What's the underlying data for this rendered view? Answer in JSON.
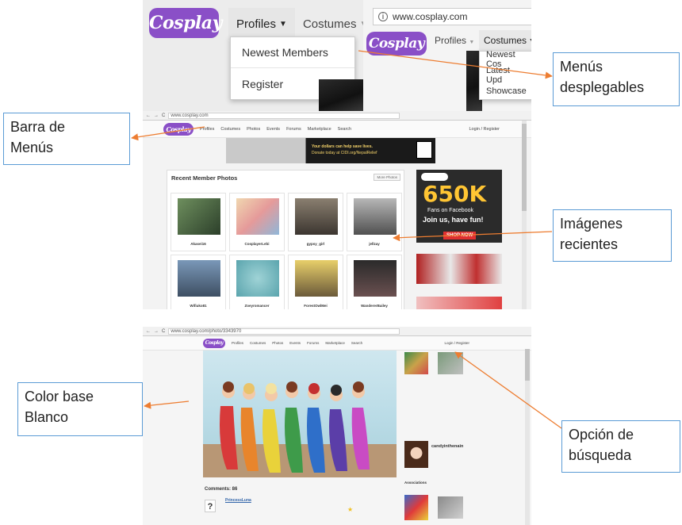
{
  "callouts": {
    "menus_dropdown": [
      "Menús",
      "desplegables"
    ],
    "menu_bar": [
      "Barra de",
      "Menús"
    ],
    "recent_images": [
      "Imágenes",
      "recientes"
    ],
    "base_color": [
      "Color base",
      "Blanco"
    ],
    "search_option": [
      "Opción de",
      "búsqueda"
    ]
  },
  "colors": {
    "accent_arrow": "#ed7d31",
    "callout_border": "#5b9bd5",
    "logo_purple": "#8a4fc7"
  },
  "top": {
    "logo": "Cosplay",
    "tabs": [
      "Profiles",
      "Costumes"
    ],
    "dropdown": [
      "Newest Members",
      "Register"
    ],
    "address": "www.cosplay.com",
    "right_tabs": [
      "Profiles",
      "Costumes"
    ],
    "right_dropdown": [
      "Newest Cos",
      "Latest Upd",
      "Showcase"
    ]
  },
  "mid": {
    "address": "www.cosplay.com",
    "nav": [
      "Profiles",
      "Costumes",
      "Photos",
      "Events",
      "Forums",
      "Marketplace",
      "Search"
    ],
    "login": "Login / Register",
    "banner_text": [
      "Your dollars can help save lives.",
      "Donate today at CIDI.org/NepalRelief"
    ],
    "panel_title": "Recent Member Photos",
    "more_button": "More Photos",
    "members": [
      "Akasei16",
      "CosplayerLebi",
      "gypsy_girl",
      "jellzay",
      "Wifiuko81",
      "Zoeyromancer",
      "ForestOwlMei",
      "WandererBailey"
    ],
    "ad": {
      "count": "650K",
      "line1": "Fans on Facebook",
      "line2": "Join us, have fun!",
      "cta": "SHOP NOW"
    }
  },
  "bot": {
    "address": "www.cosplay.com/photo/3343970",
    "nav": [
      "Profiles",
      "Costumes",
      "Photos",
      "Events",
      "Forums",
      "Marketplace",
      "Search"
    ],
    "login": "Login / Register",
    "comments_title": "Comments: 86",
    "comment_user": "PrincessLuna",
    "profile_name": "candyinthenain",
    "side_label": "Associations"
  }
}
